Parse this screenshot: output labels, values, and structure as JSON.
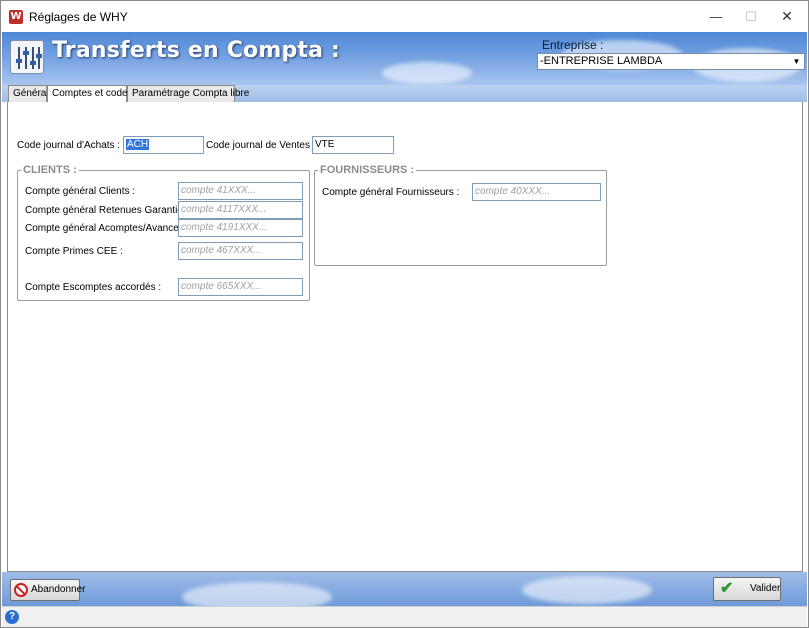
{
  "window": {
    "title": "Réglages de WHY",
    "app_icon_letter": "W",
    "minimize": "—",
    "maximize": "☐",
    "close": "✕"
  },
  "header": {
    "title": "Transferts en Compta :",
    "entreprise_label": "Entreprise :",
    "entreprise_value": "-ENTREPRISE LAMBDA",
    "dropdown_arrow": "▼"
  },
  "tabs": [
    {
      "label": "Général",
      "active": false
    },
    {
      "label": "Comptes et codes",
      "active": true
    },
    {
      "label": "Paramétrage Compta libre",
      "active": false
    }
  ],
  "journals": {
    "achats_label": "Code journal d'Achats :",
    "achats_value": "ACH",
    "ventes_label": "Code journal de Ventes :",
    "ventes_value": "VTE"
  },
  "clients": {
    "title": "CLIENTS :",
    "rows": [
      {
        "label": "Compte général Clients :",
        "placeholder": "compte 41XXX..."
      },
      {
        "label": "Compte général Retenues Garantie :",
        "placeholder": "compte 4117XXX..."
      },
      {
        "label": "Compte général Acomptes/Avances :",
        "placeholder": "compte 4191XXX..."
      },
      {
        "label": "Compte Primes CEE :",
        "placeholder": "compte 467XXX..."
      },
      {
        "label": "Compte Escomptes accordés :",
        "placeholder": "compte 665XXX..."
      }
    ]
  },
  "fournisseurs": {
    "title": "FOURNISSEURS :",
    "rows": [
      {
        "label": "Compte général Fournisseurs :",
        "placeholder": "compte 40XXX..."
      }
    ]
  },
  "footer": {
    "abandon_label": "Abandonner",
    "valider_label": "Valider"
  },
  "statusbar": {
    "help_icon_text": "?"
  },
  "colors": {
    "header_sky": "#5b8ddb",
    "selection": "#3377dd",
    "group_title": "#8c8c8c",
    "valider_check": "#2e9a2e",
    "abandon_red": "#cc2020"
  }
}
